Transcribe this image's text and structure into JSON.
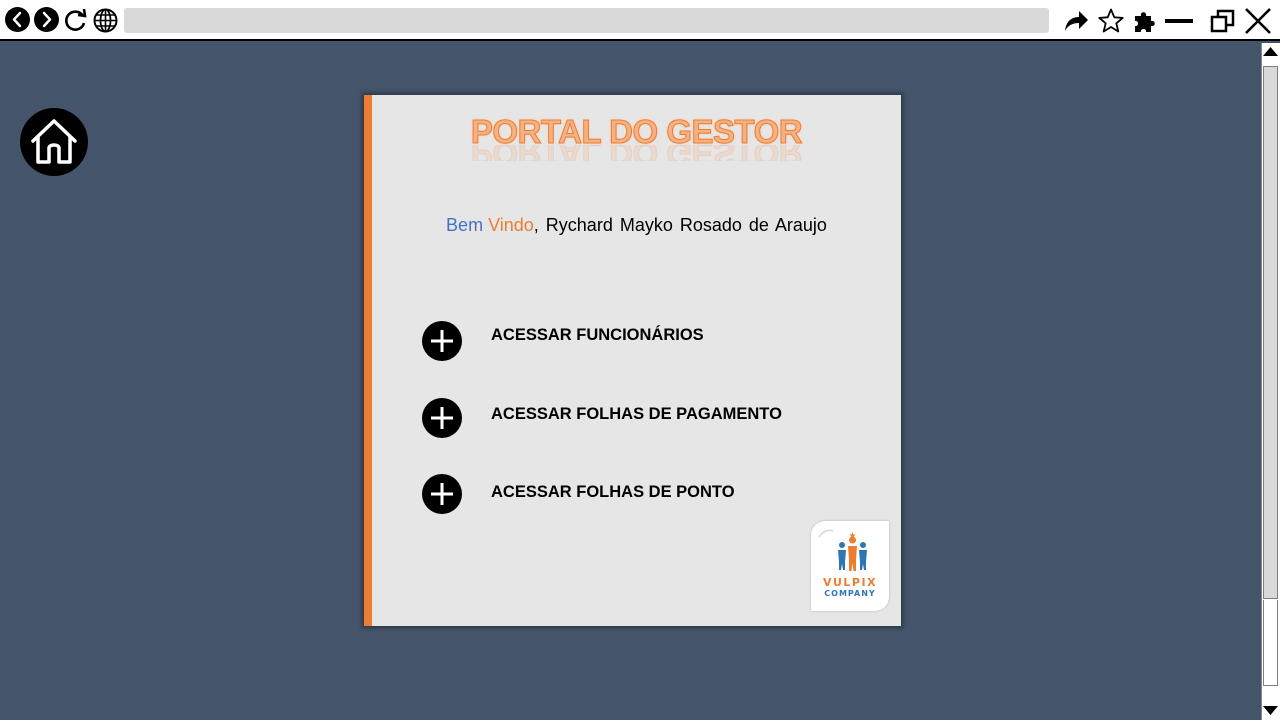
{
  "browser": {
    "address_value": "",
    "icons": [
      "back-icon",
      "forward-icon",
      "reload-icon",
      "globe-icon",
      "share-icon",
      "star-icon",
      "puzzle-icon",
      "minimize-icon",
      "restore-icon",
      "close-icon"
    ]
  },
  "card": {
    "title": "PORTAL DO GESTOR",
    "welcome": {
      "word1": "Bem",
      "word2": "Vindo",
      "rest": ", Rychard Mayko Rosado de Araujo"
    },
    "menu": [
      {
        "label": "ACESSAR FUNCIONÁRIOS"
      },
      {
        "label": "ACESSAR FOLHAS DE PAGAMENTO"
      },
      {
        "label": "ACESSAR FOLHAS DE PONTO"
      }
    ],
    "logo": {
      "line1": "VULPIX",
      "line2": "COMPANY"
    }
  },
  "colors": {
    "background": "#44546a",
    "accent_orange": "#ed7d31",
    "accent_blue": "#4472c4",
    "card": "#e7e6e6"
  }
}
